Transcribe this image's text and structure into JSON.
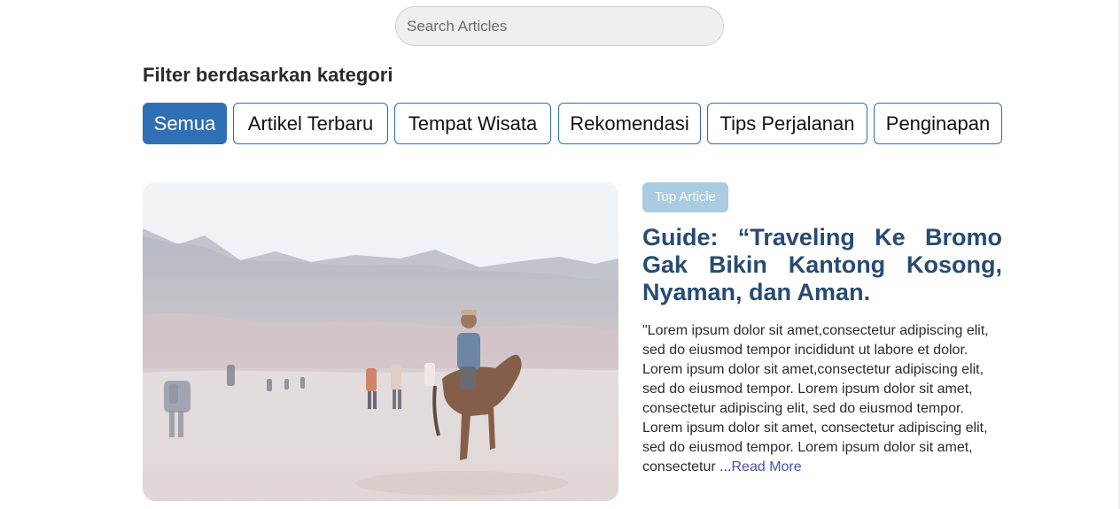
{
  "search": {
    "placeholder": "Search Articles",
    "value": ""
  },
  "filter": {
    "heading": "Filter berdasarkan kategori",
    "categories": [
      {
        "label": "Semua",
        "active": true
      },
      {
        "label": "Artikel Terbaru",
        "active": false
      },
      {
        "label": "Tempat Wisata",
        "active": false
      },
      {
        "label": "Rekomendasi",
        "active": false
      },
      {
        "label": "Tips Perjalanan",
        "active": false
      },
      {
        "label": "Penginapan",
        "active": false
      }
    ]
  },
  "featured": {
    "badge": "Top Article",
    "title": "Guide: “Traveling Ke Bromo Gak Bikin Kantong Kosong, Nyaman, dan Aman.",
    "excerpt": "\"Lorem ipsum dolor sit amet,consectetur adipiscing elit, sed do eiusmod tempor incididunt ut labore et dolor. Lorem ipsum dolor sit amet,consectetur adipiscing elit, sed do eiusmod tempor. Lorem ipsum dolor sit amet, consectetur adipiscing elit, sed do eiusmod tempor. Lorem ipsum dolor sit amet, consectetur adipiscing elit, sed do eiusmod tempor. Lorem ipsum dolor sit amet, consectetur ...",
    "read_more": "Read More",
    "image_subject": "horse-rider-bromo-desert-photo"
  },
  "colors": {
    "accent": "#2f6fb3",
    "title": "#274b73",
    "badge": "#a9cce3",
    "link": "#4b4fb8"
  }
}
